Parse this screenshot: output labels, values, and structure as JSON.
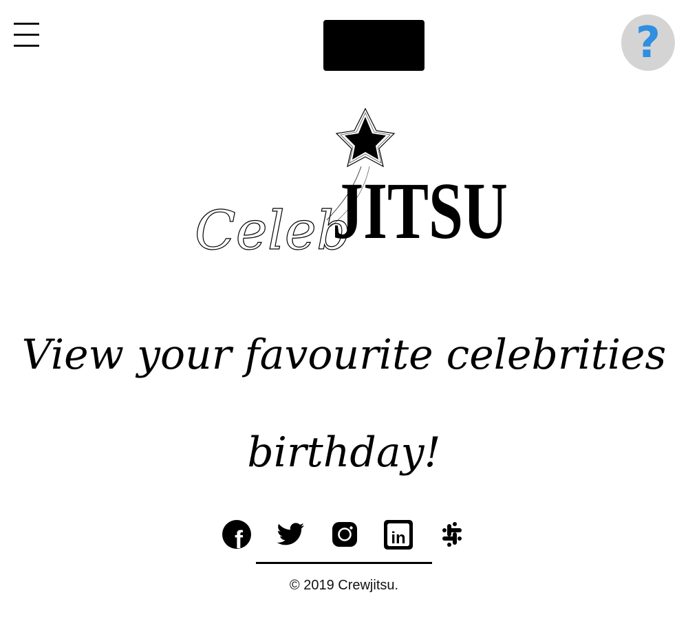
{
  "header": {
    "menu_icon": "hamburger-icon",
    "help_icon": "question-mark-icon",
    "help_symbol": "?"
  },
  "logo": {
    "script_text": "Celeb",
    "block_text": "JITSU"
  },
  "tagline": {
    "line1": "View your favourite celebrities",
    "line2": "birthday!"
  },
  "social": [
    {
      "name": "facebook-icon",
      "glyph": "f"
    },
    {
      "name": "twitter-icon"
    },
    {
      "name": "instagram-icon"
    },
    {
      "name": "linkedin-icon",
      "glyph": "in"
    },
    {
      "name": "slack-icon"
    }
  ],
  "footer": {
    "copyright": "© 2019 Crewjitsu."
  },
  "colors": {
    "background": "#ffffff",
    "text": "#000000",
    "help_bg": "#d4d4d4",
    "help_accent": "#2f8fe0"
  }
}
